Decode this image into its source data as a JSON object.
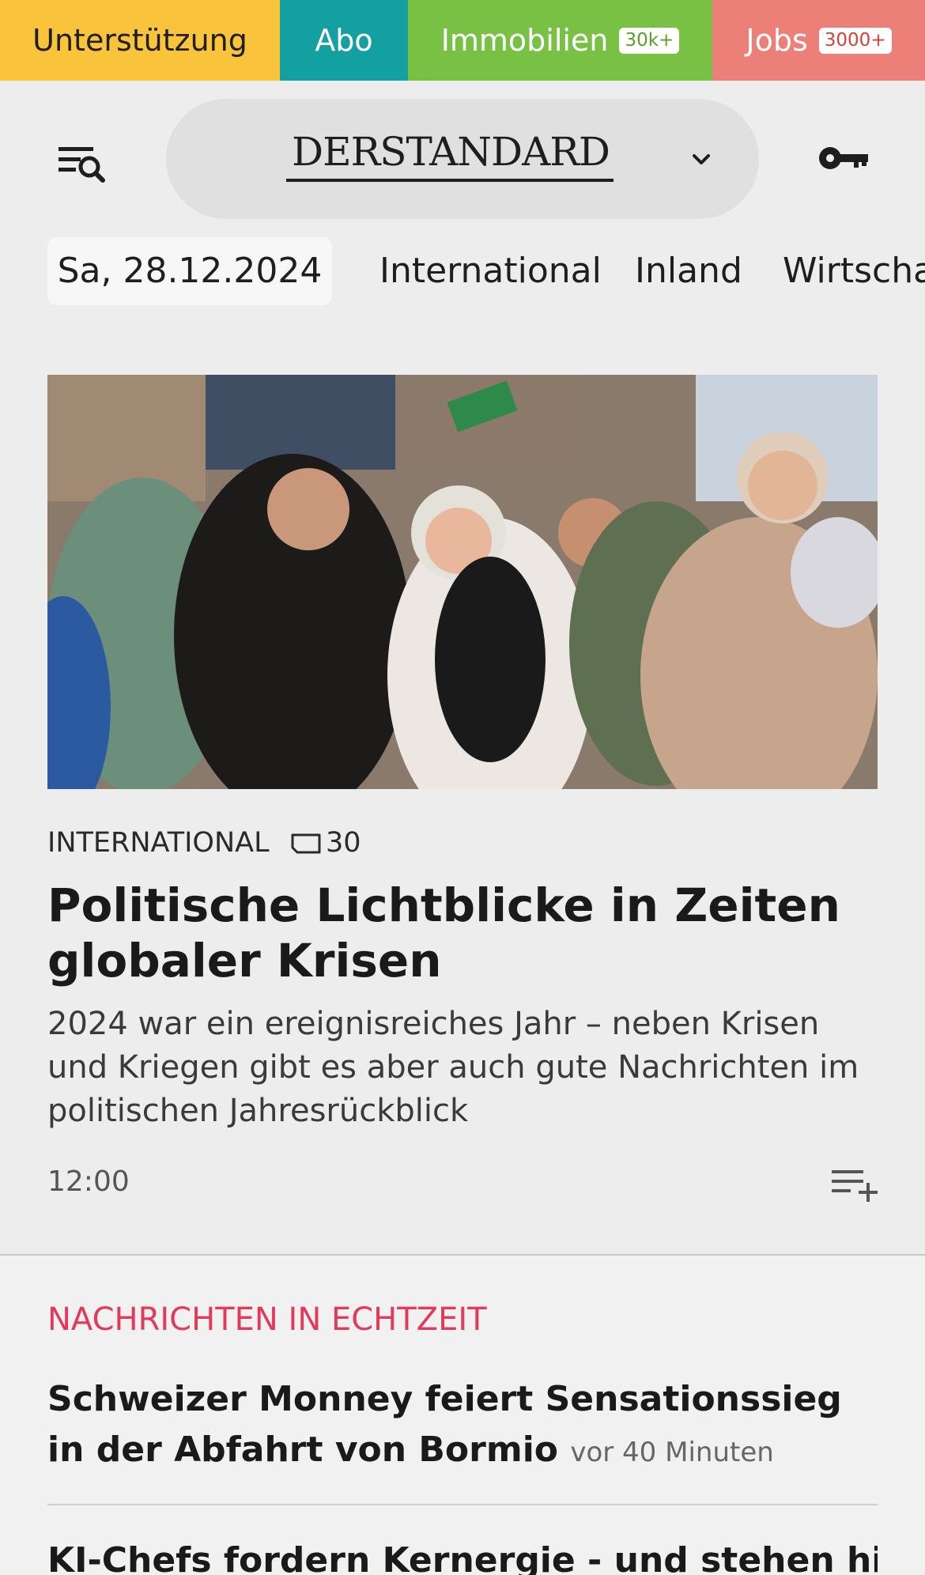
{
  "topbar": {
    "support_label": "Unterstützung",
    "abo_label": "Abo",
    "immo_label": "Immobilien",
    "immo_badge": "30k+",
    "jobs_label": "Jobs",
    "jobs_badge": "3000+"
  },
  "header": {
    "logo_text": "DERSTANDARD",
    "menu_icon": "menu-search-icon",
    "chevron_icon": "chevron-down-icon",
    "login_icon": "key-icon"
  },
  "nav": {
    "date": "Sa, 28.12.2024",
    "items": [
      "International",
      "Inland",
      "Wirtschaft"
    ]
  },
  "hero": {
    "kicker": "INTERNATIONAL",
    "comment_count": "30",
    "headline": "Politische Lichtblicke in Zeiten globaler Krisen",
    "lead": "2024 war ein ereignisreiches Jahr – neben Krisen und Kriegen gibt es aber auch gute Nachrichten im politischen Jahresrückblick",
    "time": "12:00",
    "playlist_icon": "playlist-add-icon"
  },
  "live": {
    "title": "NACHRICHTEN IN ECHTZEIT",
    "items": [
      {
        "headline": "Schweizer Monney feiert Sensationssieg in der Abfahrt von Bormio",
        "ago": "vor 40 Minuten"
      },
      {
        "headline": "KI-Chefs fordern Kernergie - und stehen hinter"
      }
    ]
  },
  "colors": {
    "support": "#f9c33c",
    "abo": "#14a0a0",
    "immo": "#78c145",
    "jobs": "#ec7f77",
    "live_accent": "#e23a58"
  }
}
